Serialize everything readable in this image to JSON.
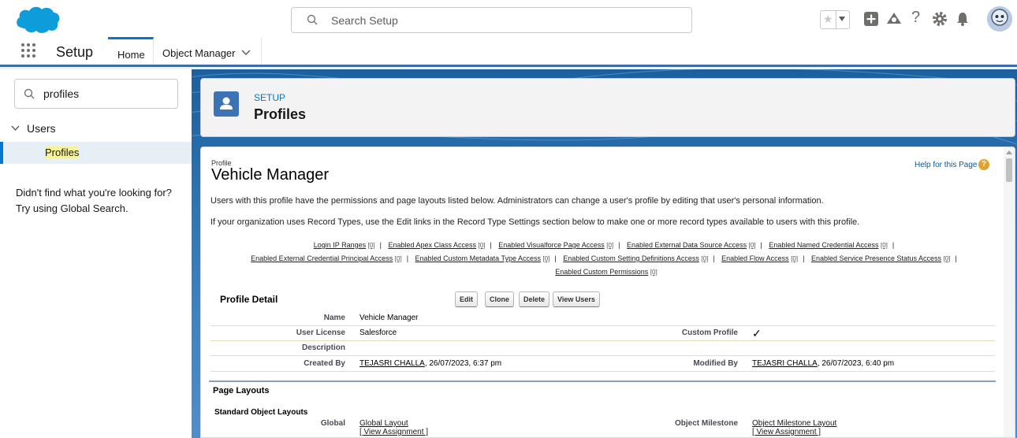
{
  "header": {
    "search_placeholder": "Search Setup",
    "icons": [
      "favorites-star-icon",
      "add-icon",
      "trailhead-icon",
      "help-icon",
      "gear-icon",
      "notifications-bell-icon",
      "user-avatar"
    ]
  },
  "nav": {
    "app_name": "Setup",
    "tabs": [
      {
        "label": "Home",
        "active": true
      },
      {
        "label": "Object Manager",
        "active": false
      }
    ]
  },
  "sidebar": {
    "quick_find_value": "profiles",
    "tree_section": "Users",
    "tree_item": "Profiles",
    "not_found_text": "Didn't find what you're looking for? Try using Global Search."
  },
  "page_header": {
    "kicker": "SETUP",
    "title": "Profiles"
  },
  "content": {
    "type_label": "Profile",
    "profile_name": "Vehicle Manager",
    "help_link": "Help for this Page",
    "desc1": "Users with this profile have the permissions and page layouts listed below. Administrators can change a user's profile by editing that user's personal information.",
    "desc2": "If your organization uses Record Types, use the Edit links in the Record Type Settings section below to make one or more record types available to users with this profile.",
    "related_links": [
      {
        "label": "Login IP Ranges",
        "count": "[0]"
      },
      {
        "label": "Enabled Apex Class Access",
        "count": "[0]"
      },
      {
        "label": "Enabled Visualforce Page Access",
        "count": "[0]"
      },
      {
        "label": "Enabled External Data Source Access",
        "count": "[0]"
      },
      {
        "label": "Enabled Named Credential Access",
        "count": "[0]"
      },
      {
        "label": "Enabled External Credential Principal Access",
        "count": "[0]"
      },
      {
        "label": "Enabled Custom Metadata Type Access",
        "count": "[0]"
      },
      {
        "label": "Enabled Custom Setting Definitions Access",
        "count": "[0]"
      },
      {
        "label": "Enabled Flow Access",
        "count": "[0]"
      },
      {
        "label": "Enabled Service Presence Status Access",
        "count": "[0]"
      },
      {
        "label": "Enabled Custom Permissions",
        "count": "[0]"
      }
    ],
    "detail_title": "Profile Detail",
    "buttons": {
      "edit": "Edit",
      "clone": "Clone",
      "delete": "Delete",
      "view_users": "View Users"
    },
    "fields": {
      "name_label": "Name",
      "name_value": "Vehicle Manager",
      "license_label": "User License",
      "license_value": "Salesforce",
      "custom_label": "Custom Profile",
      "custom_value": "✓",
      "description_label": "Description",
      "description_value": "",
      "created_label": "Created By",
      "created_user": "TEJASRI CHALLA",
      "created_date": ", 26/07/2023, 6:37 pm",
      "modified_label": "Modified By",
      "modified_user": "TEJASRI CHALLA",
      "modified_date": ", 26/07/2023, 6:40 pm"
    },
    "page_layouts_title": "Page Layouts",
    "standard_layouts_title": "Standard Object Layouts",
    "layouts": {
      "global_label": "Global",
      "global_layout": "Global Layout",
      "global_assign": "[ View Assignment ]",
      "milestone_label": "Object Milestone",
      "milestone_layout": "Object Milestone Layout",
      "milestone_assign": "[ View Assignment ]"
    }
  },
  "colors": {
    "brand_blue": "#0176d3",
    "header_band": "#1b5f9e",
    "highlight": "#f7f39b",
    "help_orange": "#e3a22a"
  }
}
